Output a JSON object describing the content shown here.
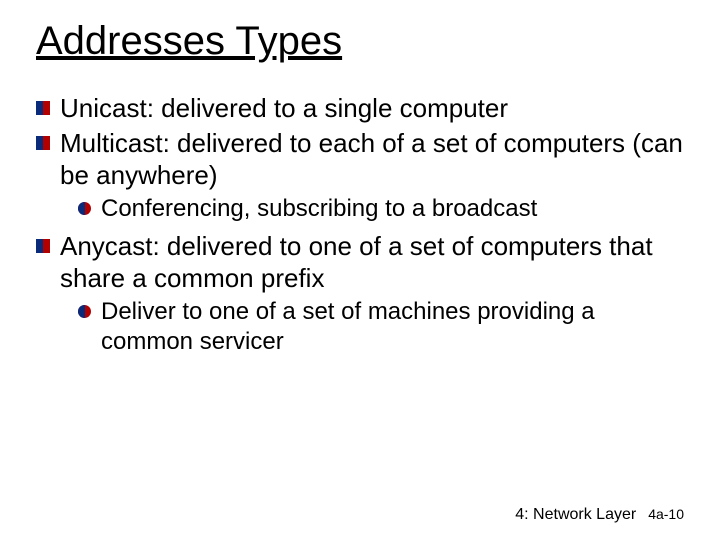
{
  "title": "Addresses Types",
  "bullets": {
    "b1": "Unicast: delivered to a single computer",
    "b2": "Multicast: delivered to each of a set of computers (can be anywhere)",
    "b2_sub1": "Conferencing, subscribing to a broadcast",
    "b3": "Anycast: delivered to one of a set of computers that share a common prefix",
    "b3_sub1": "Deliver to one of a set of machines providing a common servicer"
  },
  "footer": {
    "section": "4: Network Layer",
    "page": "4a-10"
  }
}
